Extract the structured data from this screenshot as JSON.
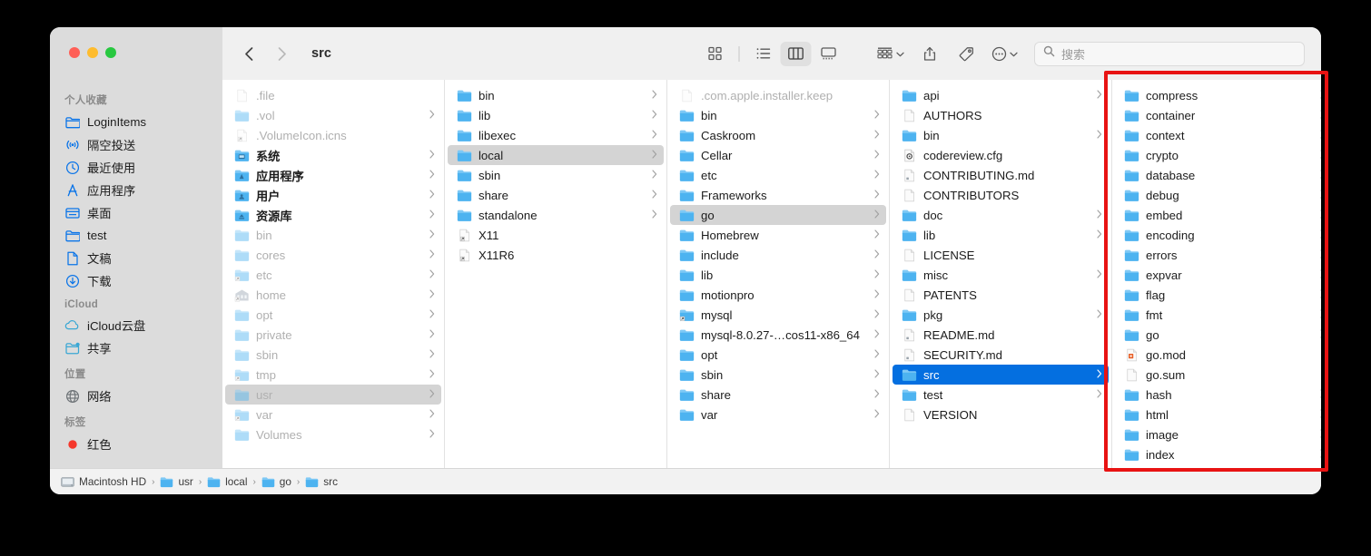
{
  "window": {
    "title": "src",
    "traffic_lights": [
      "close",
      "minimize",
      "zoom"
    ]
  },
  "toolbar": {
    "back_label": "back",
    "forward_label": "forward",
    "views": [
      {
        "name": "icon-view",
        "active": false
      },
      {
        "name": "list-view",
        "active": false
      },
      {
        "name": "column-view",
        "active": true
      },
      {
        "name": "gallery-view",
        "active": false
      }
    ],
    "group_by_label": "group-by",
    "share_label": "share",
    "tag_label": "tag",
    "more_label": "more"
  },
  "search": {
    "placeholder": "搜索",
    "value": ""
  },
  "sidebar": {
    "sections": [
      {
        "title": "个人收藏",
        "items": [
          {
            "label": "LoginItems",
            "icon": "folder-outline-icon"
          },
          {
            "label": "隔空投送",
            "icon": "airdrop-icon"
          },
          {
            "label": "最近使用",
            "icon": "clock-icon"
          },
          {
            "label": "应用程序",
            "icon": "applications-icon"
          },
          {
            "label": "桌面",
            "icon": "desktop-icon"
          },
          {
            "label": "test",
            "icon": "folder-outline-icon"
          },
          {
            "label": "文稿",
            "icon": "document-icon"
          },
          {
            "label": "下载",
            "icon": "downloads-icon"
          }
        ]
      },
      {
        "title": "iCloud",
        "items": [
          {
            "label": "iCloud云盘",
            "icon": "cloud-icon"
          },
          {
            "label": "共享",
            "icon": "shared-folder-icon"
          }
        ]
      },
      {
        "title": "位置",
        "items": [
          {
            "label": "网络",
            "icon": "network-globe-icon"
          }
        ]
      },
      {
        "title": "标签",
        "items": [
          {
            "label": "红色",
            "icon": "red-tag-icon"
          }
        ]
      }
    ]
  },
  "columns": [
    {
      "name": "column-root",
      "rows": [
        {
          "label": ".file",
          "icon": "file",
          "arrow": false,
          "dim": true
        },
        {
          "label": ".vol",
          "icon": "folder",
          "arrow": true,
          "dim": true
        },
        {
          "label": ".VolumeIcon.icns",
          "icon": "alias",
          "arrow": false,
          "dim": true
        },
        {
          "label": "系统",
          "icon": "sysfolder",
          "arrow": true,
          "bold": true
        },
        {
          "label": "应用程序",
          "icon": "appfolder",
          "arrow": true,
          "bold": true
        },
        {
          "label": "用户",
          "icon": "usersfolder",
          "arrow": true,
          "bold": true
        },
        {
          "label": "资源库",
          "icon": "libfolder",
          "arrow": true,
          "bold": true
        },
        {
          "label": "bin",
          "icon": "folder",
          "arrow": true,
          "dim": true
        },
        {
          "label": "cores",
          "icon": "folder",
          "arrow": true,
          "dim": true
        },
        {
          "label": "etc",
          "icon": "alias-folder",
          "arrow": true,
          "dim": true
        },
        {
          "label": "home",
          "icon": "homefolder",
          "arrow": true,
          "dim": true
        },
        {
          "label": "opt",
          "icon": "folder",
          "arrow": true,
          "dim": true
        },
        {
          "label": "private",
          "icon": "folder",
          "arrow": true,
          "dim": true
        },
        {
          "label": "sbin",
          "icon": "folder",
          "arrow": true,
          "dim": true
        },
        {
          "label": "tmp",
          "icon": "alias-folder",
          "arrow": true,
          "dim": true
        },
        {
          "label": "usr",
          "icon": "folder",
          "arrow": true,
          "dim": true,
          "selected": "inactive"
        },
        {
          "label": "var",
          "icon": "alias-folder",
          "arrow": true,
          "dim": true
        },
        {
          "label": "Volumes",
          "icon": "folder",
          "arrow": true,
          "dim": true
        }
      ]
    },
    {
      "name": "column-usr",
      "rows": [
        {
          "label": "bin",
          "icon": "folder",
          "arrow": true
        },
        {
          "label": "lib",
          "icon": "folder",
          "arrow": true
        },
        {
          "label": "libexec",
          "icon": "folder",
          "arrow": true
        },
        {
          "label": "local",
          "icon": "folder",
          "arrow": true,
          "selected": "inactive"
        },
        {
          "label": "sbin",
          "icon": "folder",
          "arrow": true
        },
        {
          "label": "share",
          "icon": "folder",
          "arrow": true
        },
        {
          "label": "standalone",
          "icon": "folder",
          "arrow": true
        },
        {
          "label": "X11",
          "icon": "alias",
          "arrow": false
        },
        {
          "label": "X11R6",
          "icon": "alias",
          "arrow": false
        }
      ]
    },
    {
      "name": "column-local",
      "rows": [
        {
          "label": ".com.apple.installer.keep",
          "icon": "file",
          "arrow": false,
          "dim": true
        },
        {
          "label": "bin",
          "icon": "folder",
          "arrow": true
        },
        {
          "label": "Caskroom",
          "icon": "folder",
          "arrow": true
        },
        {
          "label": "Cellar",
          "icon": "folder",
          "arrow": true
        },
        {
          "label": "etc",
          "icon": "folder",
          "arrow": true
        },
        {
          "label": "Frameworks",
          "icon": "folder",
          "arrow": true
        },
        {
          "label": "go",
          "icon": "folder",
          "arrow": true,
          "selected": "inactive"
        },
        {
          "label": "Homebrew",
          "icon": "folder",
          "arrow": true
        },
        {
          "label": "include",
          "icon": "folder",
          "arrow": true
        },
        {
          "label": "lib",
          "icon": "folder",
          "arrow": true
        },
        {
          "label": "motionpro",
          "icon": "folder",
          "arrow": true
        },
        {
          "label": "mysql",
          "icon": "alias-folder",
          "arrow": true
        },
        {
          "label": "mysql-8.0.27-…cos11-x86_64",
          "icon": "folder",
          "arrow": true
        },
        {
          "label": "opt",
          "icon": "folder",
          "arrow": true
        },
        {
          "label": "sbin",
          "icon": "folder",
          "arrow": true
        },
        {
          "label": "share",
          "icon": "folder",
          "arrow": true
        },
        {
          "label": "var",
          "icon": "folder",
          "arrow": true
        }
      ]
    },
    {
      "name": "column-go",
      "rows": [
        {
          "label": "api",
          "icon": "folder",
          "arrow": true
        },
        {
          "label": "AUTHORS",
          "icon": "file",
          "arrow": false
        },
        {
          "label": "bin",
          "icon": "folder",
          "arrow": true
        },
        {
          "label": "codereview.cfg",
          "icon": "config",
          "arrow": false
        },
        {
          "label": "CONTRIBUTING.md",
          "icon": "doc",
          "arrow": false
        },
        {
          "label": "CONTRIBUTORS",
          "icon": "file",
          "arrow": false
        },
        {
          "label": "doc",
          "icon": "folder",
          "arrow": true
        },
        {
          "label": "lib",
          "icon": "folder",
          "arrow": true
        },
        {
          "label": "LICENSE",
          "icon": "file",
          "arrow": false
        },
        {
          "label": "misc",
          "icon": "folder",
          "arrow": true
        },
        {
          "label": "PATENTS",
          "icon": "file",
          "arrow": false
        },
        {
          "label": "pkg",
          "icon": "folder",
          "arrow": true
        },
        {
          "label": "README.md",
          "icon": "doc",
          "arrow": false
        },
        {
          "label": "SECURITY.md",
          "icon": "doc",
          "arrow": false
        },
        {
          "label": "src",
          "icon": "folder",
          "arrow": true,
          "selected": "active"
        },
        {
          "label": "test",
          "icon": "folder",
          "arrow": true
        },
        {
          "label": "VERSION",
          "icon": "file",
          "arrow": false
        }
      ]
    },
    {
      "name": "column-src",
      "rows": [
        {
          "label": "compress",
          "icon": "folder",
          "arrow": true
        },
        {
          "label": "container",
          "icon": "folder",
          "arrow": true
        },
        {
          "label": "context",
          "icon": "folder",
          "arrow": true
        },
        {
          "label": "crypto",
          "icon": "folder",
          "arrow": true
        },
        {
          "label": "database",
          "icon": "folder",
          "arrow": true
        },
        {
          "label": "debug",
          "icon": "folder",
          "arrow": true
        },
        {
          "label": "embed",
          "icon": "folder",
          "arrow": true
        },
        {
          "label": "encoding",
          "icon": "folder",
          "arrow": true
        },
        {
          "label": "errors",
          "icon": "folder",
          "arrow": true
        },
        {
          "label": "expvar",
          "icon": "folder",
          "arrow": true
        },
        {
          "label": "flag",
          "icon": "folder",
          "arrow": true
        },
        {
          "label": "fmt",
          "icon": "folder",
          "arrow": true
        },
        {
          "label": "go",
          "icon": "folder",
          "arrow": true
        },
        {
          "label": "go.mod",
          "icon": "gomod",
          "arrow": false
        },
        {
          "label": "go.sum",
          "icon": "file",
          "arrow": false
        },
        {
          "label": "hash",
          "icon": "folder",
          "arrow": true
        },
        {
          "label": "html",
          "icon": "folder",
          "arrow": true
        },
        {
          "label": "image",
          "icon": "folder",
          "arrow": true
        },
        {
          "label": "index",
          "icon": "folder",
          "arrow": true
        }
      ]
    }
  ],
  "pathbar": {
    "crumbs": [
      {
        "label": "Macintosh HD",
        "icon": "harddisk"
      },
      {
        "label": "usr",
        "icon": "folder"
      },
      {
        "label": "local",
        "icon": "folder"
      },
      {
        "label": "go",
        "icon": "folder"
      },
      {
        "label": "src",
        "icon": "folder"
      }
    ],
    "separator": "›"
  },
  "annotation": {
    "type": "highlight-rectangle",
    "color": "#e81313",
    "target": "column-src"
  }
}
